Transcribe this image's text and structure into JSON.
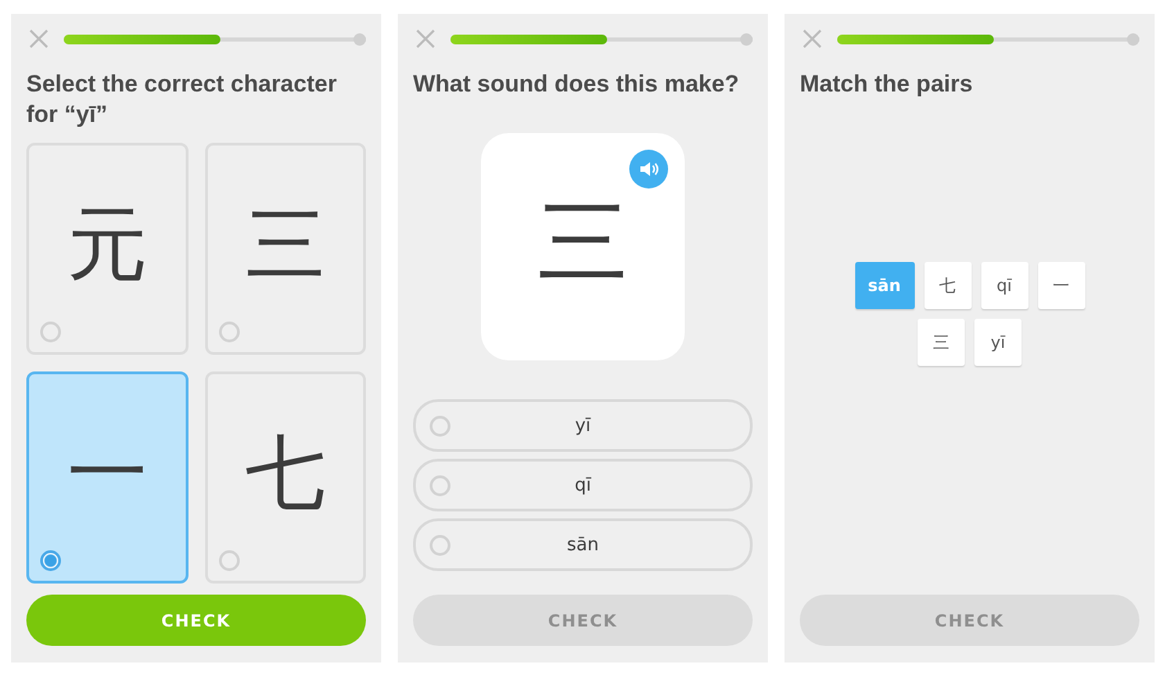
{
  "screens": [
    {
      "kind": "select_character",
      "progress": {
        "level": 0.52
      },
      "title": "Select the correct character for “yī”",
      "choices": [
        {
          "character": "元",
          "selected": false
        },
        {
          "character": "三",
          "selected": false
        },
        {
          "character": "一",
          "selected": true
        },
        {
          "character": "七",
          "selected": false
        }
      ],
      "check_button": {
        "label": "CHECK",
        "disabled": false
      }
    },
    {
      "kind": "listen_choose",
      "progress": {
        "level": 0.52
      },
      "title": "What sound does this make?",
      "prompt_character": "三",
      "options": [
        {
          "label": "yī",
          "selected": false
        },
        {
          "label": "qī",
          "selected": false
        },
        {
          "label": "sān",
          "selected": false
        }
      ],
      "check_button": {
        "label": "CHECK",
        "disabled": true
      }
    },
    {
      "kind": "match_pairs",
      "progress": {
        "level": 0.52
      },
      "title": "Match the pairs",
      "tiles": [
        {
          "label": "sān",
          "selected": true
        },
        {
          "label": "七",
          "selected": false
        },
        {
          "label": "qī",
          "selected": false
        },
        {
          "label": "一",
          "selected": false
        },
        {
          "label": "三",
          "selected": false
        },
        {
          "label": "yī",
          "selected": false
        }
      ],
      "check_button": {
        "label": "CHECK",
        "disabled": true
      }
    }
  ]
}
